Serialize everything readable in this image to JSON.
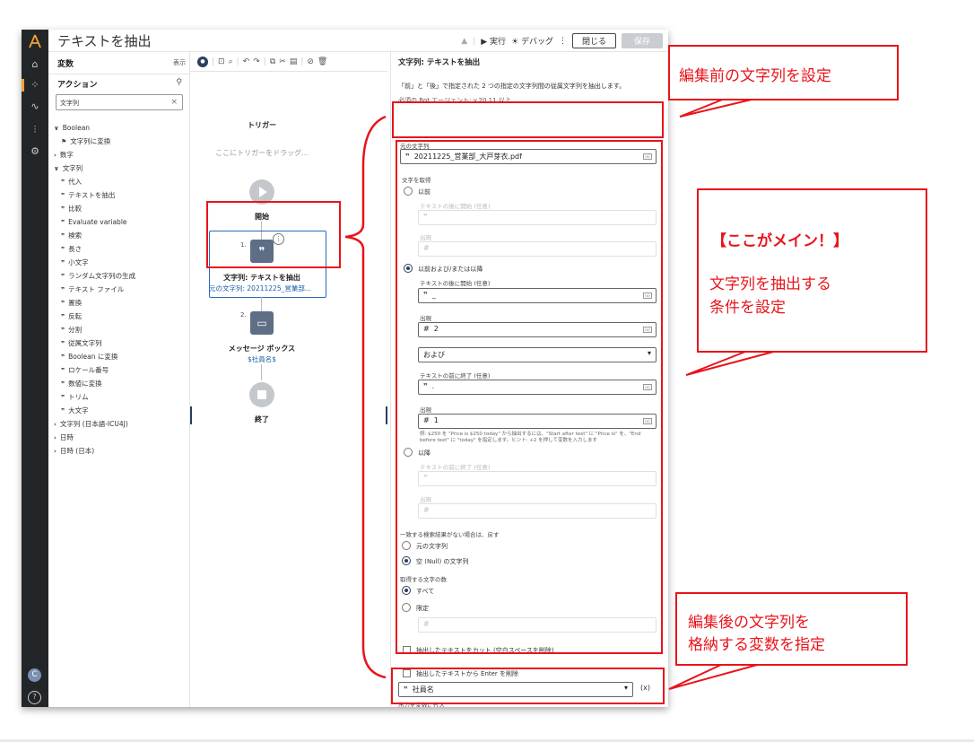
{
  "window": {
    "title": "テキストを抽出"
  },
  "titlebar": {
    "run_label": "▶ 実行",
    "debug_label": "☀ デバッグ",
    "close_label": "閉じる",
    "save_label": "保存"
  },
  "variables_panel": {
    "heading": "変数",
    "show_label": "表示",
    "actions_heading": "アクション",
    "search_value": "文字列",
    "tree": [
      {
        "type": "group",
        "expanded": true,
        "label": "Boolean"
      },
      {
        "type": "item",
        "icon": "flag",
        "label": "文字列に変換"
      },
      {
        "type": "group",
        "expanded": false,
        "label": "数字"
      },
      {
        "type": "group",
        "expanded": true,
        "label": "文字列"
      },
      {
        "type": "item",
        "icon": "quote",
        "label": "代入"
      },
      {
        "type": "item",
        "icon": "quote",
        "label": "テキストを抽出"
      },
      {
        "type": "item",
        "icon": "quote",
        "label": "比較"
      },
      {
        "type": "item",
        "icon": "quote",
        "label": "Evaluate variable"
      },
      {
        "type": "item",
        "icon": "quote",
        "label": "検索"
      },
      {
        "type": "item",
        "icon": "quote",
        "label": "長さ"
      },
      {
        "type": "item",
        "icon": "quote",
        "label": "小文字"
      },
      {
        "type": "item",
        "icon": "quote",
        "label": "ランダム文字列の生成"
      },
      {
        "type": "item",
        "icon": "quote",
        "label": "テキスト ファイル"
      },
      {
        "type": "item",
        "icon": "quote",
        "label": "置換"
      },
      {
        "type": "item",
        "icon": "quote",
        "label": "反転"
      },
      {
        "type": "item",
        "icon": "quote",
        "label": "分割"
      },
      {
        "type": "item",
        "icon": "quote",
        "label": "従属文字列"
      },
      {
        "type": "item",
        "icon": "quote",
        "label": "Boolean に変換"
      },
      {
        "type": "item",
        "icon": "quote",
        "label": "ロケール番号"
      },
      {
        "type": "item",
        "icon": "quote",
        "label": "数値に変換"
      },
      {
        "type": "item",
        "icon": "quote",
        "label": "トリム"
      },
      {
        "type": "item",
        "icon": "quote",
        "label": "大文字"
      },
      {
        "type": "group",
        "expanded": false,
        "label": "文字列 (日本語-ICU4J)"
      },
      {
        "type": "group",
        "expanded": false,
        "label": "日時"
      },
      {
        "type": "group",
        "expanded": false,
        "label": "日時 (日本)"
      }
    ]
  },
  "flow": {
    "trigger_label": "トリガー",
    "trigger_drop": "ここにトリガーをドラッグ...",
    "start_label": "開始",
    "node1": {
      "num": "1.",
      "label": "文字列: テキストを抽出",
      "sub": "元の文字列: 20211225_営業部..."
    },
    "node2": {
      "num": "2.",
      "label": "メッセージ ボックス",
      "sub": "$社員名$"
    },
    "end_label": "終了"
  },
  "properties": {
    "title": "文字列: テキストを抽出",
    "description": "「前」と「後」で指定された 2 つの指定の文字列間の従属文字列を抽出します。",
    "requirement": "必須の Bot エージェント: v.20.11 以上",
    "source_label": "元の文字列",
    "source_value": "20211225_営業部_大戸芽衣.pdf",
    "get_text_label": "文字を取得",
    "opt_before": "以前",
    "before_start_label": "テキストの後に開始 (任意)",
    "before_start_value": "",
    "before_occ_label": "出現",
    "opt_before_after": "以前および/または以降",
    "start_after_label": "テキストの後に開始 (任意)",
    "start_after_value": "_",
    "occ1_label": "出現",
    "occ1_value": "2",
    "and_select": "および",
    "end_before_label": "テキストの前に終了 (任意)",
    "end_before_value": ".",
    "occ2_label": "出現",
    "occ2_value": "1",
    "hint": "例: $250 を \"Price is $250 today\" から抽出するには、\"Start after text\" に \"Price is\" を、\"End before text\" に \"today\" を指定します。ヒント: +2 を押して変数を入力します",
    "opt_after": "以降",
    "after_end_label": "テキストの前に終了 (任意)",
    "after_occ_label": "出現",
    "no_match_label": "一致する検索結果がない場合は、戻す",
    "opt_source_string": "元の文字列",
    "opt_null": "空 (Null) の文字列",
    "count_label": "取得する文字の数",
    "opt_all": "すべて",
    "opt_limit": "限定",
    "chk_trim": "抽出したテキストをカット (空白スペースを削除)",
    "chk_enter": "抽出したテキストから Enter を削除",
    "output_label": "出力を変数に代入",
    "output_value": "社員名"
  },
  "callouts": {
    "c1": "編集前の文字列を設定",
    "c2_title": "【ここがメイン！】",
    "c2_line1": "文字列を抽出する",
    "c2_line2": "条件を設定",
    "c3_line1": "編集後の文字列を",
    "c3_line2": "格納する変数を指定"
  },
  "colors": {
    "annotation_red": "#e8141b",
    "rail_dark": "#232629",
    "link_blue": "#1a5fa8"
  }
}
